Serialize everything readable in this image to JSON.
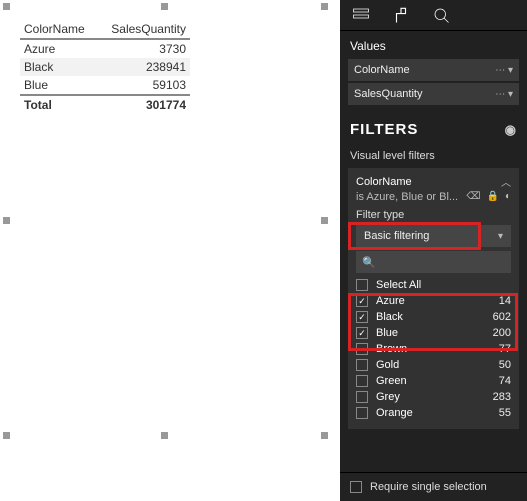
{
  "table": {
    "headers": {
      "col1": "ColorName",
      "col2": "SalesQuantity"
    },
    "rows": [
      {
        "name": "Azure",
        "qty": "3730"
      },
      {
        "name": "Black",
        "qty": "238941"
      },
      {
        "name": "Blue",
        "qty": "59103"
      }
    ],
    "total_label": "Total",
    "total_value": "301774"
  },
  "panel": {
    "values_label": "Values",
    "fields": {
      "f1": "ColorName",
      "f2": "SalesQuantity"
    },
    "filters_header": "FILTERS",
    "visual_filters_label": "Visual level filters",
    "card": {
      "title": "ColorName",
      "summary": "is Azure, Blue or Bl...",
      "filter_type_label": "Filter type",
      "dropdown_value": "Basic filtering",
      "items": [
        {
          "label": "Select All",
          "checked": false,
          "count": ""
        },
        {
          "label": "Azure",
          "checked": true,
          "count": "14"
        },
        {
          "label": "Black",
          "checked": true,
          "count": "602"
        },
        {
          "label": "Blue",
          "checked": true,
          "count": "200"
        },
        {
          "label": "Brown",
          "checked": false,
          "count": "77"
        },
        {
          "label": "Gold",
          "checked": false,
          "count": "50"
        },
        {
          "label": "Green",
          "checked": false,
          "count": "74"
        },
        {
          "label": "Grey",
          "checked": false,
          "count": "283"
        },
        {
          "label": "Orange",
          "checked": false,
          "count": "55"
        }
      ]
    },
    "require_single": "Require single selection"
  }
}
